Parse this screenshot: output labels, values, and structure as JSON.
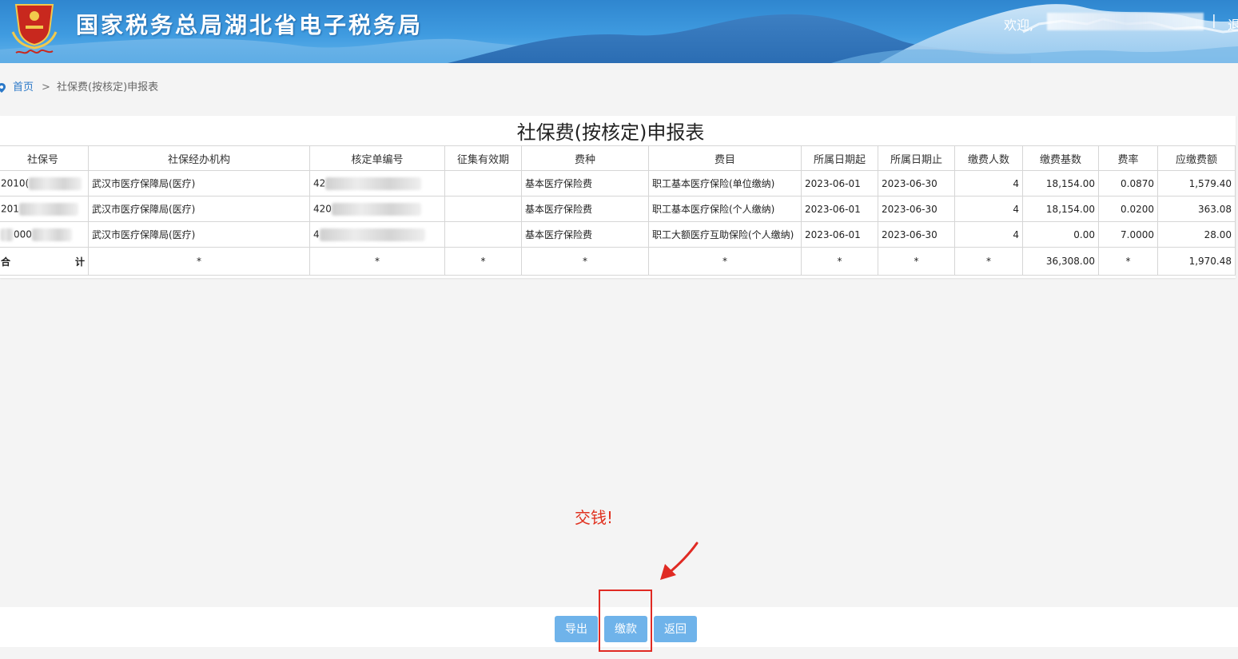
{
  "header": {
    "site_title": "国家税务总局湖北省电子税务局",
    "welcome": "欢迎,",
    "separator": "|",
    "logout_partial": "退",
    "banner_color": "#3f9be0"
  },
  "breadcrumb": {
    "home": "首页",
    "arrow": ">",
    "current": "社保费(按核定)申报表"
  },
  "report": {
    "title": "社保费(按核定)申报表",
    "columns": [
      "社保号",
      "社保经办机构",
      "核定单编号",
      "征集有效期",
      "费种",
      "费目",
      "所属日期起",
      "所属日期止",
      "缴费人数",
      "缴费基数",
      "费率",
      "应缴费额"
    ],
    "rows": [
      {
        "ssn_prefix": "2010(",
        "agency": "武汉市医疗保障局(医疗)",
        "order_prefix": "42",
        "validity": "",
        "fee_type": "基本医疗保险费",
        "fee_item": "职工基本医疗保险(单位缴纳)",
        "date_start": "2023-06-01",
        "date_end": "2023-06-30",
        "headcount": "4",
        "base": "18,154.00",
        "rate": "0.0870",
        "amount": "1,579.40"
      },
      {
        "ssn_prefix": "201",
        "agency": "武汉市医疗保障局(医疗)",
        "order_prefix": "420",
        "validity": "",
        "fee_type": "基本医疗保险费",
        "fee_item": "职工基本医疗保险(个人缴纳)",
        "date_start": "2023-06-01",
        "date_end": "2023-06-30",
        "headcount": "4",
        "base": "18,154.00",
        "rate": "0.0200",
        "amount": "363.08"
      },
      {
        "ssn_prefix": "000",
        "agency": "武汉市医疗保障局(医疗)",
        "order_prefix": "4",
        "validity": "",
        "fee_type": "基本医疗保险费",
        "fee_item": "职工大额医疗互助保险(个人缴纳)",
        "date_start": "2023-06-01",
        "date_end": "2023-06-30",
        "headcount": "4",
        "base": "0.00",
        "rate": "7.0000",
        "amount": "28.00"
      }
    ],
    "total": {
      "label_left": "合",
      "label_right": "计",
      "star": "*",
      "base": "36,308.00",
      "amount": "1,970.48"
    }
  },
  "annotation": {
    "text": "交钱!",
    "color": "#e0301e"
  },
  "buttons": {
    "export": "导出",
    "pay": "缴款",
    "back": "返回",
    "color": "#6fb3ea"
  }
}
